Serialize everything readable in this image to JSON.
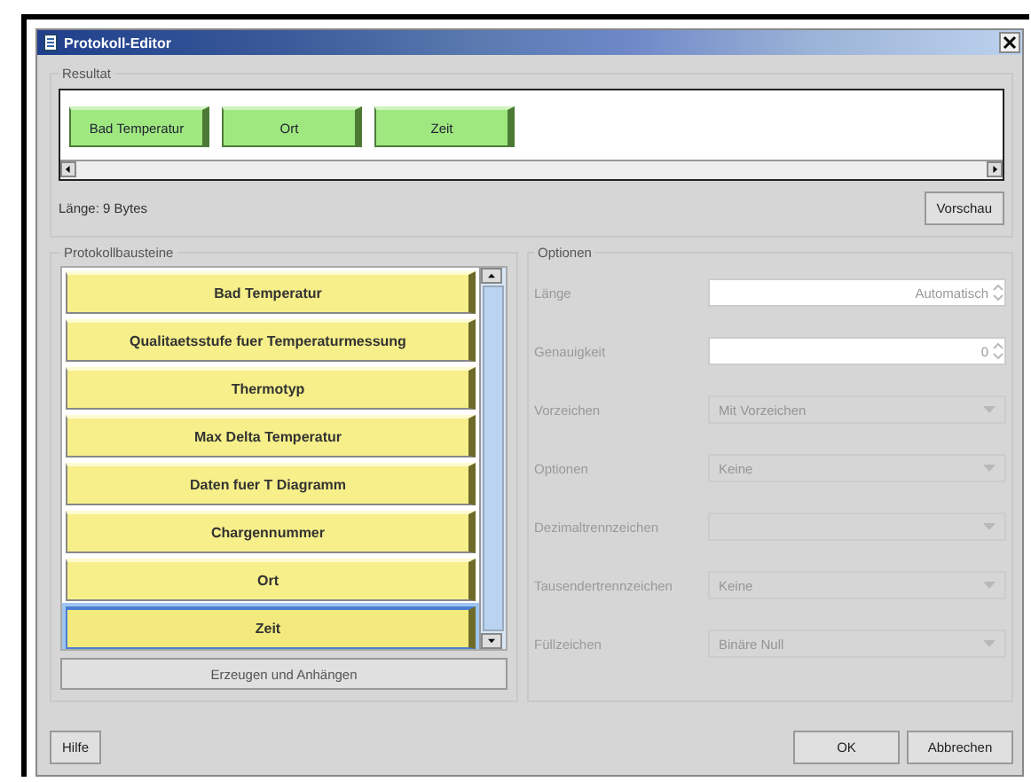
{
  "window": {
    "title": "Protokoll-Editor"
  },
  "result": {
    "label": "Resultat",
    "chips": [
      "Bad Temperatur",
      "Ort",
      "Zeit"
    ],
    "length": "Länge: 9 Bytes",
    "preview_button": "Vorschau"
  },
  "blocks": {
    "label": "Protokollbausteine",
    "items": [
      {
        "label": "Bad Temperatur",
        "selected": false
      },
      {
        "label": "Qualitaetsstufe fuer Temperaturmessung",
        "selected": false
      },
      {
        "label": "Thermotyp",
        "selected": false
      },
      {
        "label": "Max Delta Temperatur",
        "selected": false
      },
      {
        "label": "Daten fuer T Diagramm",
        "selected": false
      },
      {
        "label": "Chargennummer",
        "selected": false
      },
      {
        "label": "Ort",
        "selected": false
      },
      {
        "label": "Zeit",
        "selected": true
      }
    ],
    "button": "Erzeugen und Anhängen"
  },
  "options": {
    "label": "Optionen",
    "rows": [
      {
        "label": "Länge",
        "kind": "spinner",
        "value": "Automatisch",
        "disabled": true
      },
      {
        "label": "Genauigkeit",
        "kind": "spinner",
        "value": "0",
        "disabled": true
      },
      {
        "label": "Vorzeichen",
        "kind": "combo",
        "value": "Mit Vorzeichen",
        "disabled": true
      },
      {
        "label": "Optionen",
        "kind": "combo",
        "value": "Keine",
        "disabled": true
      },
      {
        "label": "Dezimaltrennzeichen",
        "kind": "combo",
        "value": "",
        "disabled": true
      },
      {
        "label": "Tausendertrennzeichen",
        "kind": "combo",
        "value": "Keine",
        "disabled": true
      },
      {
        "label": "Füllzeichen",
        "kind": "combo",
        "value": "Binäre Null",
        "disabled": true
      }
    ]
  },
  "buttons": {
    "help": "Hilfe",
    "ok": "OK",
    "cancel": "Abbrechen"
  }
}
